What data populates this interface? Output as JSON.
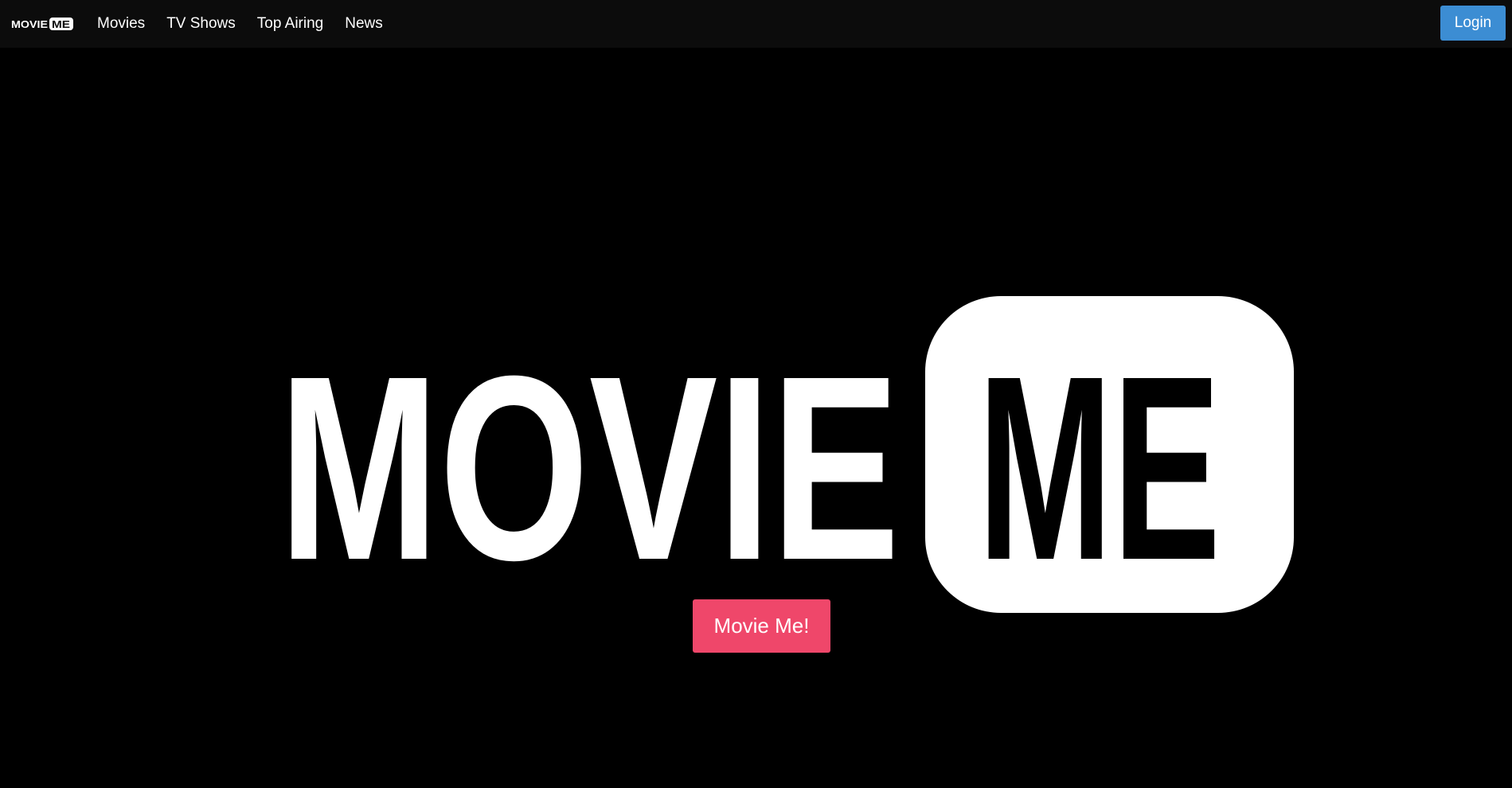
{
  "brand": {
    "logo_text_left": "MOVIE",
    "logo_text_right": "ME",
    "icon": "moviesme-logo"
  },
  "nav": {
    "links": [
      {
        "label": "Movies"
      },
      {
        "label": "TV Shows"
      },
      {
        "label": "Top Airing"
      },
      {
        "label": "News"
      }
    ],
    "login_label": "Login"
  },
  "hero": {
    "logo_text_left": "MOVIE",
    "logo_text_right": "ME",
    "cta_label": "Movie Me!"
  },
  "colors": {
    "background": "#000000",
    "navbar": "#0c0c0c",
    "login": "#3c8dd3",
    "cta": "#ef476a",
    "logo": "#ffffff"
  }
}
